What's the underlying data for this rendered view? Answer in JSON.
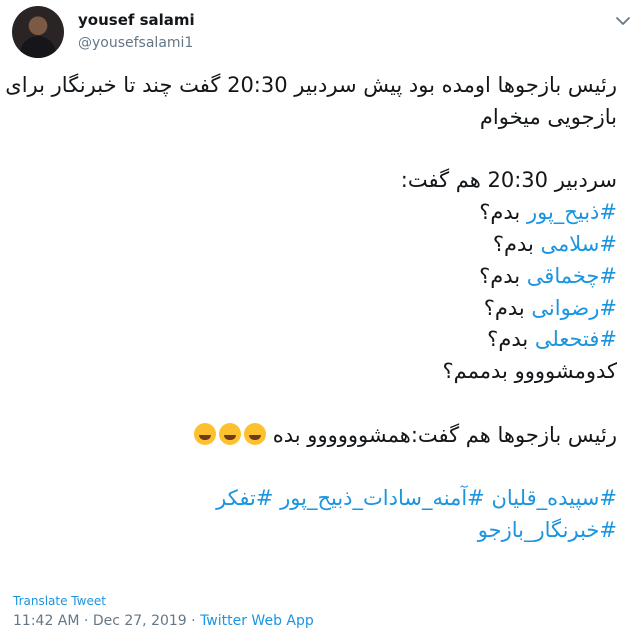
{
  "author": {
    "name": "yousef salami",
    "handle": "@yousefsalami1"
  },
  "tweet": {
    "line1": "رئیس بازجوها اومده بود پیش سردبیر 20:30 گفت چند تا خبرنگار برای",
    "line2": "بازجویی میخوام",
    "line3": "سردبیر 20:30 هم گفت:",
    "list": [
      {
        "tag": "#ذبیح_پور",
        "suffix": " بدم؟"
      },
      {
        "tag": "#سلامی",
        "suffix": " بدم؟"
      },
      {
        "tag": "#چخماقی",
        "suffix": " بدم؟"
      },
      {
        "tag": "#رضوانی",
        "suffix": " بدم؟"
      },
      {
        "tag": "#فتحعلی",
        "suffix": " بدم؟"
      }
    ],
    "line_last_q": "کدومشوووو بدممم؟",
    "reply_line": "رئیس بازجوها هم گفت:همشوووووو بده",
    "emojis": [
      "rolling-laughing-emoji",
      "tears-of-joy-emoji",
      "rolling-laughing-emoji"
    ],
    "hashtags_line1": [
      "#سپیده_قلیان",
      "#آمنه_سادات_ذبیح_پور",
      "#تفکر"
    ],
    "hashtags_line2": [
      "#خبرنگار_بازجو"
    ]
  },
  "footer": {
    "translate": "Translate Tweet",
    "time": "11:42 AM",
    "date": "Dec 27, 2019",
    "separator": "·",
    "app": "Twitter Web App"
  },
  "colors": {
    "link": "#1b95e0",
    "text": "#14171a",
    "muted": "#657786"
  }
}
